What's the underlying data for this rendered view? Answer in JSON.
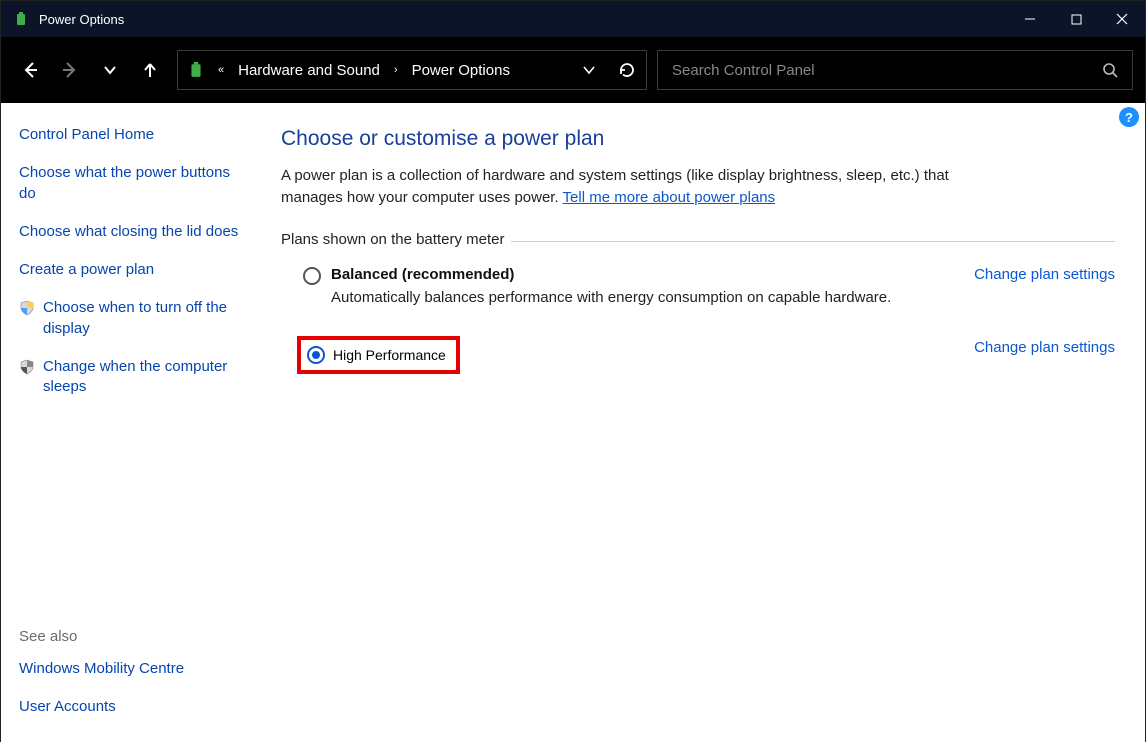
{
  "window": {
    "title": "Power Options"
  },
  "breadcrumb": {
    "parent": "Hardware and Sound",
    "current": "Power Options"
  },
  "search": {
    "placeholder": "Search Control Panel"
  },
  "sidebar": {
    "home": "Control Panel Home",
    "links": [
      "Choose what the power buttons do",
      "Choose what closing the lid does",
      "Create a power plan",
      "Choose when to turn off the display",
      "Change when the computer sleeps"
    ],
    "see_also_header": "See also",
    "see_also": [
      "Windows Mobility Centre",
      "User Accounts"
    ]
  },
  "main": {
    "heading": "Choose or customise a power plan",
    "intro_text": "A power plan is a collection of hardware and system settings (like display brightness, sleep, etc.) that manages how your computer uses power. ",
    "intro_link": "Tell me more about power plans",
    "legend": "Plans shown on the battery meter",
    "plans": [
      {
        "name": "Balanced (recommended)",
        "desc": "Automatically balances performance with energy consumption on capable hardware.",
        "change": "Change plan settings",
        "selected": false
      },
      {
        "name": "High Performance",
        "desc": "",
        "change": "Change plan settings",
        "selected": true
      }
    ]
  }
}
